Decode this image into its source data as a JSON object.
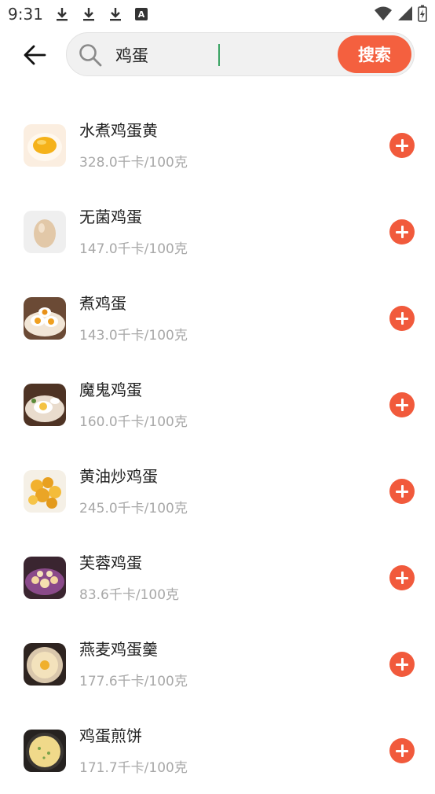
{
  "status_bar": {
    "time": "9:31",
    "icons": [
      "download-icon",
      "download-icon",
      "download-icon",
      "a-icon",
      "wifi-icon",
      "signal-icon",
      "battery-icon"
    ],
    "a_label": "A"
  },
  "search": {
    "query": "鸡蛋",
    "button_label": "搜索"
  },
  "colors": {
    "accent": "#f4603f",
    "add_button": "#f15a3c",
    "caret": "#3aa363"
  },
  "results": [
    {
      "name": "水煮鸡蛋黄",
      "calories": "328.0千卡/100克",
      "thumb": "egg-yolk-image"
    },
    {
      "name": "无菌鸡蛋",
      "calories": "147.0千卡/100克",
      "thumb": "egg-image"
    },
    {
      "name": "煮鸡蛋",
      "calories": "143.0千卡/100克",
      "thumb": "boiled-eggs-image"
    },
    {
      "name": "魔鬼鸡蛋",
      "calories": "160.0千卡/100克",
      "thumb": "deviled-eggs-image"
    },
    {
      "name": "黄油炒鸡蛋",
      "calories": "245.0千卡/100克",
      "thumb": "butter-eggs-image"
    },
    {
      "name": "芙蓉鸡蛋",
      "calories": "83.6千卡/100克",
      "thumb": "furong-eggs-image"
    },
    {
      "name": "燕麦鸡蛋羹",
      "calories": "177.6千卡/100克",
      "thumb": "oat-egg-custard-image"
    },
    {
      "name": "鸡蛋煎饼",
      "calories": "171.7千卡/100克",
      "thumb": "egg-pancake-image"
    }
  ]
}
